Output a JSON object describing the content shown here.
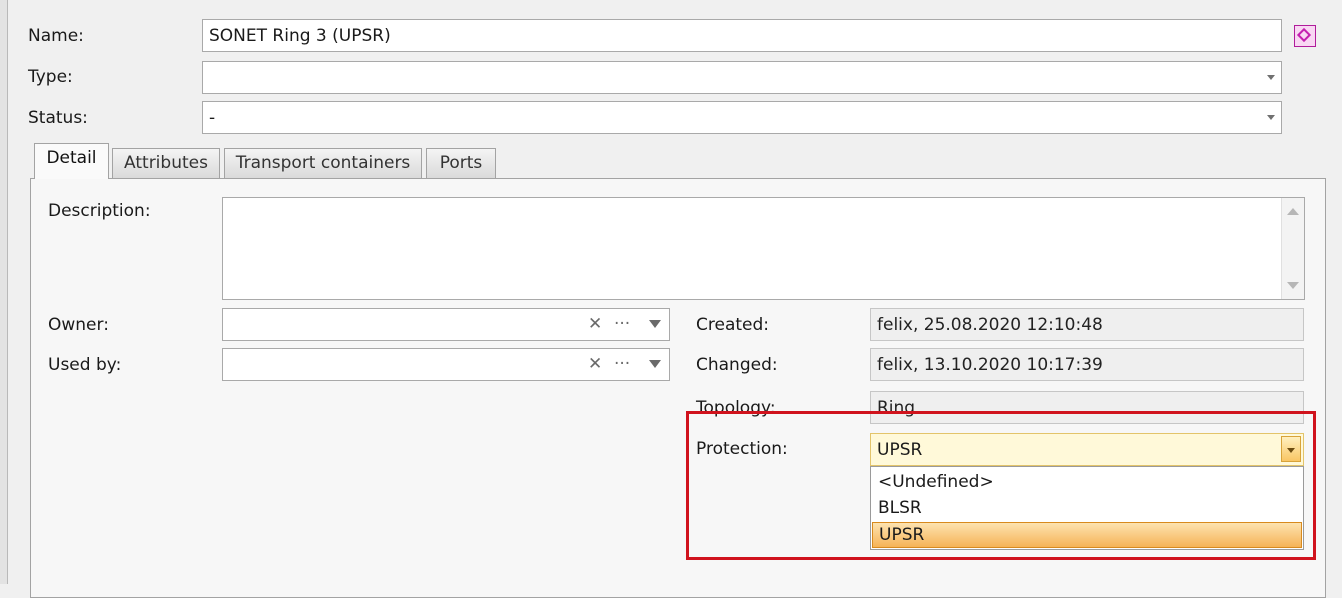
{
  "form": {
    "name_label": "Name:",
    "name_value": "SONET Ring 3 (UPSR)",
    "type_label": "Type:",
    "type_value": "",
    "status_label": "Status:",
    "status_value": "-"
  },
  "tabs": [
    {
      "label": "Detail",
      "active": true
    },
    {
      "label": "Attributes",
      "active": false
    },
    {
      "label": "Transport containers",
      "active": false
    },
    {
      "label": "Ports",
      "active": false
    }
  ],
  "detail": {
    "description_label": "Description:",
    "description_value": "",
    "owner_label": "Owner:",
    "owner_value": "",
    "usedby_label": "Used by:",
    "usedby_value": "",
    "clear_glyph": "✕",
    "more_glyph": "···",
    "created_label": "Created:",
    "created_value": "felix, 25.08.2020 12:10:48",
    "changed_label": "Changed:",
    "changed_value": "felix, 13.10.2020 10:17:39",
    "topology_label": "Topology:",
    "topology_value": "Ring",
    "protection_label": "Protection:",
    "protection_value": "UPSR",
    "protection_options": [
      "<Undefined>",
      "BLSR",
      "UPSR"
    ],
    "protection_selected_index": 2
  },
  "colors": {
    "highlight_border": "#d0131d",
    "selected_option": "#f6b357",
    "icon_accent": "#c41fb0"
  },
  "icons": {
    "name_side_icon": "diamond-icon"
  }
}
